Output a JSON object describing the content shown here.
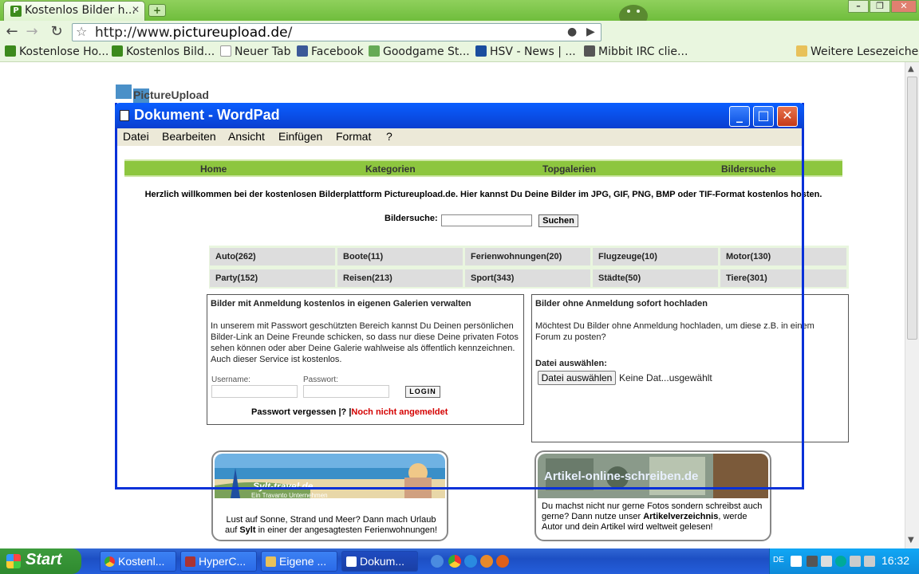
{
  "browser": {
    "tab_title": "Kostenlos Bilder h...",
    "url_prefix": "http://www.",
    "url_domain": "pictureupload.de",
    "url_suffix": "/",
    "bookmarks": [
      "Kostenlose Ho...",
      "Kostenlos Bild...",
      "Neuer Tab",
      "Facebook",
      "Goodgame St...",
      "HSV - News | ...",
      "Mibbit IRC clie..."
    ],
    "other_bookmarks": "Weitere Lesezeichen"
  },
  "site": {
    "logo": "PictureUpload",
    "nav": [
      "Home",
      "Kategorien",
      "Topgalerien",
      "Bildersuche"
    ],
    "welcome": "Herzlich willkommen bei der kostenlosen Bilderplattform Pictureupload.de. Hier kannst Du Deine Bilder im JPG, GIF, PNG, BMP oder TIF-Format kostenlos hosten.",
    "search_label": "Bildersuche:",
    "search_button": "Suchen",
    "categories": [
      "Auto(262)",
      "Boote(11)",
      "Ferienwohnungen(20)",
      "Flugzeuge(10)",
      "Motor(130)",
      "Party(152)",
      "Reisen(213)",
      "Sport(343)",
      "Städte(50)",
      "Tiere(301)"
    ],
    "login_box": {
      "heading": "Bilder mit Anmeldung kostenlos in eigenen Galerien verwalten",
      "text": "In unserem mit Passwort geschützten Bereich kannst Du Deinen persönlichen Bilder-Link an Deine Freunde schicken, so dass nur diese Deine privaten Fotos sehen können oder aber Deine Galerie wahlweise als öffentlich kennzeichnen. Auch dieser Service ist kostenlos.",
      "username_label": "Username:",
      "password_label": "Passwort:",
      "login_button": "LOGIN",
      "forgot": "Passwort vergessen",
      "help": "?",
      "not_logged_in": "Noch nicht angemeldet"
    },
    "upload_box": {
      "heading": "Bilder ohne Anmeldung sofort hochladen",
      "text": "Möchtest Du Bilder ohne Anmeldung hochladen, um diese z.B. in einem Forum zu posten?",
      "file_label": "Datei auswählen:",
      "file_button": "Datei auswählen",
      "file_status": "Keine Dat...usgewählt"
    },
    "ad_left": {
      "brand": "Sylt-travel.de",
      "tagline": "Ein Travanto Unternehmen",
      "text1": "Lust auf Sonne, Strand und Meer? Dann mach Urlaub",
      "text2_pre": "auf ",
      "text2_bold": "Sylt",
      "text2_post": " in einer der angesagtesten Ferienwohnungen!"
    },
    "ad_right": {
      "brand": "Artikel-online-schreiben.de",
      "text1": "Du machst nicht nur gerne Fotos sondern schreibst auch",
      "text2_pre": "gerne? Dann nutze unser ",
      "text2_bold": "Artikelverzeichnis",
      "text2_post": ", werde",
      "text3": "Autor und dein Artikel wird weltweit gelesen!"
    }
  },
  "wordpad": {
    "title": "Dokument - WordPad",
    "menu": [
      "Datei",
      "Bearbeiten",
      "Ansicht",
      "Einfügen",
      "Format",
      "?"
    ]
  },
  "taskbar": {
    "start": "Start",
    "tasks": [
      "Kostenl...",
      "HyperC...",
      "Eigene ...",
      "Dokum..."
    ],
    "lang": "DE",
    "clock": "16:32"
  }
}
